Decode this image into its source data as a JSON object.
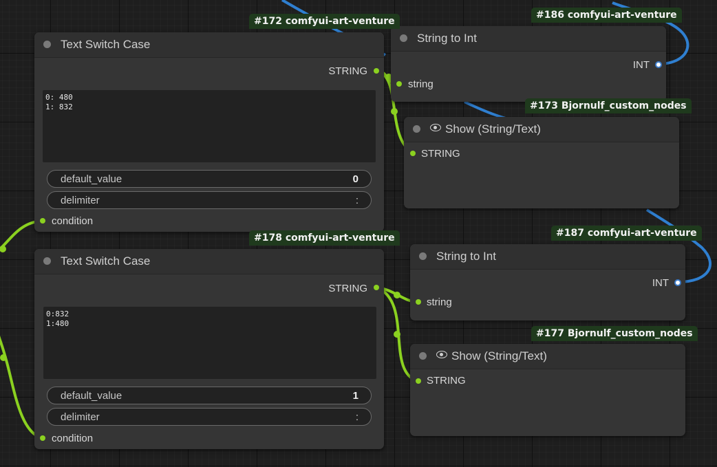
{
  "nodes": {
    "n172": {
      "badge": "#172 comfyui-art-venture",
      "title": "Text Switch Case",
      "output": "STRING",
      "text": "0: 480\n1: 832",
      "default_value_label": "default_value",
      "default_value": "0",
      "delimiter_label": "delimiter",
      "delimiter": ":",
      "input": "condition"
    },
    "n178": {
      "badge": "#178 comfyui-art-venture",
      "title": "Text Switch Case",
      "output": "STRING",
      "text": "0:832\n1:480",
      "default_value_label": "default_value",
      "default_value": "1",
      "delimiter_label": "delimiter",
      "delimiter": ":",
      "input": "condition"
    },
    "n186": {
      "badge": "#186 comfyui-art-venture",
      "title": "String to Int",
      "output": "INT",
      "input": "string"
    },
    "n187": {
      "badge": "#187 comfyui-art-venture",
      "title": "String to Int",
      "output": "INT",
      "input": "string"
    },
    "n173": {
      "badge": "#173 Bjornulf_custom_nodes",
      "title": "Show (String/Text)",
      "input": "STRING"
    },
    "n177": {
      "badge": "#177 Bjornulf_custom_nodes",
      "title": "Show (String/Text)",
      "input": "STRING"
    }
  },
  "colors": {
    "string_link": "#8bd120",
    "int_link": "#2f7fd0",
    "badge_bg": "#1f3a1d",
    "node_bg": "#353535"
  },
  "icons": {
    "show_node": "eye-icon",
    "collapse": "collapse-dot-icon"
  }
}
